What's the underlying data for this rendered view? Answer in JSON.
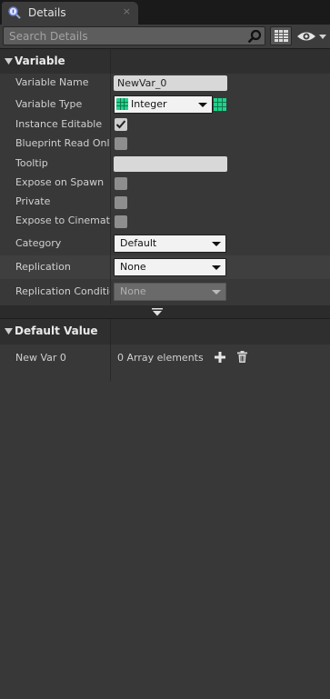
{
  "tab": {
    "title": "Details",
    "close": "×"
  },
  "search": {
    "placeholder": "Search Details"
  },
  "sections": {
    "variable": "Variable",
    "default_value": "Default Value"
  },
  "variable_rows": {
    "name_label": "Variable Name",
    "name_value": "NewVar_0",
    "type_label": "Variable Type",
    "type_value": "Integer",
    "instance_editable_label": "Instance Editable",
    "instance_editable_checked": true,
    "bp_read_only_label": "Blueprint Read Only",
    "bp_read_only_checked": false,
    "tooltip_label": "Tooltip",
    "tooltip_value": "",
    "expose_spawn_label": "Expose on Spawn",
    "expose_spawn_checked": false,
    "private_label": "Private",
    "private_checked": false,
    "expose_cinematics_label": "Expose to Cinematics",
    "expose_cinematics_checked": false,
    "category_label": "Category",
    "category_value": "Default",
    "replication_label": "Replication",
    "replication_value": "None",
    "replication_condition_label": "Replication Condition",
    "replication_condition_value": "None"
  },
  "default_value_rows": {
    "newvar_label": "New Var 0",
    "array_text": "0 Array elements"
  },
  "colors": {
    "integer_type": "#1fd38a",
    "panel_bg": "#383838",
    "header_bg": "#2f2f2f"
  },
  "icons": {
    "tab": "details-icon",
    "search": "search-icon",
    "view_options": "eye-icon",
    "property_matrix": "grid-icon",
    "add": "plus-icon",
    "delete": "trash-icon"
  }
}
